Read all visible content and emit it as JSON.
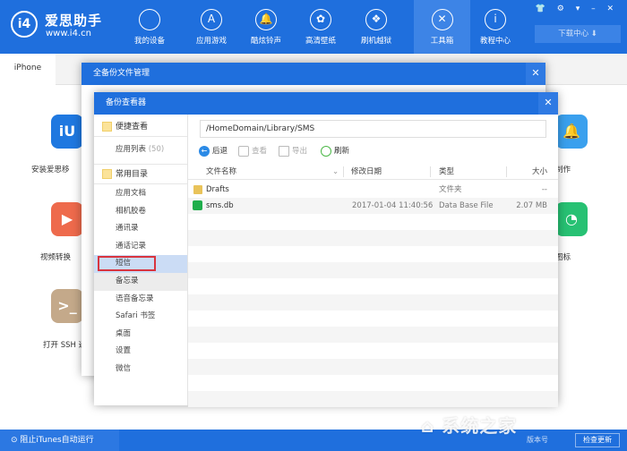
{
  "app": {
    "logo_mark": "i4",
    "name": "爱思助手",
    "url": "www.i4.cn"
  },
  "nav": [
    {
      "label": "我的设备",
      "icon": "apple-icon",
      "glyph": ""
    },
    {
      "label": "应用游戏",
      "icon": "app-store-icon",
      "glyph": "A"
    },
    {
      "label": "酷炫铃声",
      "icon": "bell-icon",
      "glyph": "🔔"
    },
    {
      "label": "高清壁纸",
      "icon": "flower-icon",
      "glyph": "✿"
    },
    {
      "label": "刷机越狱",
      "icon": "dropbox-icon",
      "glyph": "❖"
    },
    {
      "label": "工具箱",
      "icon": "tools-icon",
      "glyph": "✕",
      "active": true
    },
    {
      "label": "教程中心",
      "icon": "info-icon",
      "glyph": "i"
    }
  ],
  "window_controls": "👕 ⚙ ▾ – ✕",
  "download_center": "下载中心 ⬇",
  "tab": "iPhone",
  "tools": [
    {
      "label": "安装爱思移",
      "glyph": "iU",
      "color": "#1f78e0"
    },
    {
      "label": "视频转换",
      "glyph": "▶",
      "color": "#ee6a4c"
    },
    {
      "label": "打开 SSH 通",
      "glyph": ">_",
      "color": "#c4a98a"
    },
    {
      "label": "制作",
      "glyph": "🔔",
      "color": "#3aa0ee"
    },
    {
      "label": "图标",
      "glyph": "◔",
      "color": "#27c173"
    }
  ],
  "outer_dialog": {
    "title": "全备份文件管理",
    "close": "✕"
  },
  "viewer": {
    "title": "备份查看器",
    "close": "✕",
    "quick": {
      "title": "便捷查看",
      "items": [
        {
          "label": "应用列表",
          "count": "(50)"
        }
      ]
    },
    "common": {
      "title": "常用目录",
      "items": [
        "应用文档",
        "相机胶卷",
        "通讯录",
        "通话记录",
        "短信",
        "备忘录",
        "语音备忘录",
        "Safari 书签",
        "桌面",
        "设置",
        "微信"
      ],
      "selected": "短信"
    },
    "path": "/HomeDomain/Library/SMS",
    "toolbar": {
      "back": "后退",
      "view": "查看",
      "export": "导出",
      "refresh": "刷新"
    },
    "columns": {
      "name": "文件名称",
      "date": "修改日期",
      "type": "类型",
      "size": "大小"
    },
    "rows": [
      {
        "name": "Drafts",
        "date": "",
        "type": "文件夹",
        "size": "--",
        "icon": "folder-icon"
      },
      {
        "name": "sms.db",
        "date": "2017-01-04 11:40:56",
        "type": "Data Base File",
        "size": "2.07 MB",
        "icon": "message-icon"
      }
    ]
  },
  "status": {
    "itunes": "阻止iTunes自动运行",
    "version": "版本号",
    "check_update": "检查更新"
  },
  "watermark": "系统之家"
}
